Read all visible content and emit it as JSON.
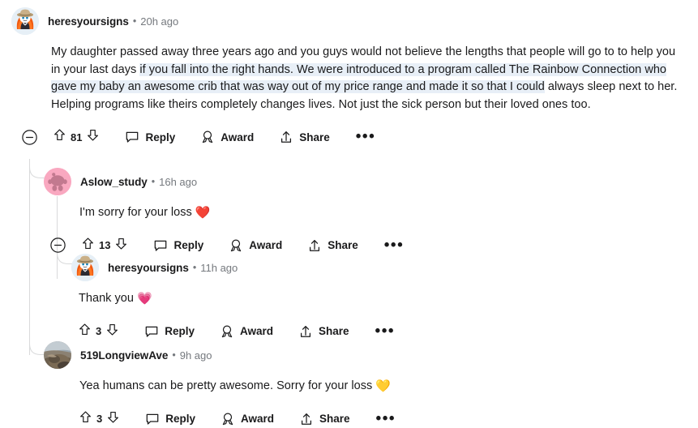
{
  "thread": {
    "comments": [
      {
        "id": "c1",
        "username": "heresyoursigns",
        "separator": "•",
        "timestamp": "20h ago",
        "avatar": "snoo-cowboy-avatar",
        "body_pre": "My daughter passed away three years ago and you guys would not believe the lengths that people will go to to help you in your last days ",
        "body_highlight": "if you fall into the right hands. We were introduced to a program called The Rainbow Connection who gave my baby an awesome crib that was way out of my price range and made it so that I could",
        "body_post": " always sleep next to her. Helping programs like theirs completely changes lives. Not just the sick person but their loved ones too.",
        "score": "81",
        "has_collapse": true,
        "actions": {
          "collapse_label": "collapse-thread",
          "upvote_label": "upvote",
          "downvote_label": "downvote",
          "reply_label": "Reply",
          "award_label": "Award",
          "share_label": "Share",
          "more_label": "•••"
        }
      },
      {
        "id": "c2",
        "username": "Aslow_study",
        "separator": "•",
        "timestamp": "16h ago",
        "avatar": "snoo-pink-avatar",
        "body_text": "I'm sorry for your loss ",
        "emoji": "❤️",
        "emoji_name": "red-heart-emoji",
        "emoji_color": "#ec1c24",
        "score": "13",
        "has_collapse": true,
        "actions": {
          "collapse_label": "collapse-thread",
          "upvote_label": "upvote",
          "downvote_label": "downvote",
          "reply_label": "Reply",
          "award_label": "Award",
          "share_label": "Share",
          "more_label": "•••"
        }
      },
      {
        "id": "c3",
        "username": "heresyoursigns",
        "separator": "•",
        "timestamp": "11h ago",
        "avatar": "snoo-cowboy-avatar",
        "body_text": "Thank you ",
        "emoji": "💗",
        "emoji_name": "pink-heart-emoji",
        "emoji_color": "#fb7faf",
        "score": "3",
        "has_collapse": false,
        "actions": {
          "upvote_label": "upvote",
          "downvote_label": "downvote",
          "reply_label": "Reply",
          "award_label": "Award",
          "share_label": "Share",
          "more_label": "•••"
        }
      },
      {
        "id": "c4",
        "username": "519LongviewAve",
        "separator": "•",
        "timestamp": "9h ago",
        "avatar": "photo-avatar",
        "body_text": "Yea humans can be pretty awesome. Sorry for your loss ",
        "emoji": "💛",
        "emoji_name": "yellow-heart-emoji",
        "emoji_color": "#f5cb3c",
        "score": "3",
        "has_collapse": false,
        "actions": {
          "upvote_label": "upvote",
          "downvote_label": "downvote",
          "reply_label": "Reply",
          "award_label": "Award",
          "share_label": "Share",
          "more_label": "•••"
        }
      }
    ]
  },
  "colors": {
    "text": "#1a1a1b",
    "meta": "#75797e",
    "thread_line": "#d9dadb",
    "selection_highlight": "#e8eff7",
    "background": "#ffffff"
  }
}
